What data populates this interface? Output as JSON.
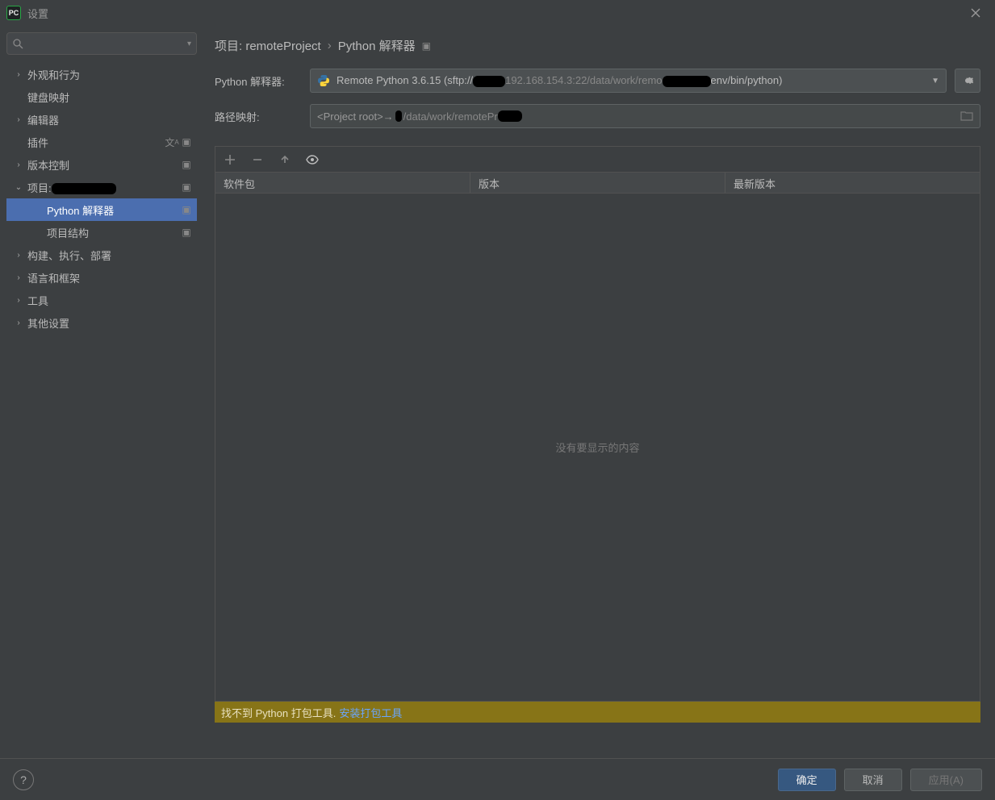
{
  "titlebar": {
    "title": "设置"
  },
  "search": {
    "placeholder": ""
  },
  "sidebar": {
    "items": [
      {
        "label": "外观和行为",
        "expandable": true,
        "level": 0,
        "selected": false
      },
      {
        "label": "键盘映射",
        "expandable": false,
        "level": 0,
        "selected": false,
        "noIndent": true
      },
      {
        "label": "编辑器",
        "expandable": true,
        "level": 0,
        "selected": false
      },
      {
        "label": "插件",
        "expandable": false,
        "level": 0,
        "selected": false,
        "noIndent": true,
        "trailing": "lang"
      },
      {
        "label": "版本控制",
        "expandable": true,
        "level": 0,
        "selected": false,
        "trailing": "square"
      },
      {
        "label": "项目:",
        "expandable": true,
        "expanded": true,
        "level": 0,
        "selected": false,
        "trailing": "square",
        "redacted": "remoteProject"
      },
      {
        "label": "Python 解释器",
        "expandable": false,
        "level": 1,
        "selected": true,
        "trailing": "square"
      },
      {
        "label": "项目结构",
        "expandable": false,
        "level": 1,
        "selected": false,
        "trailing": "square"
      },
      {
        "label": "构建、执行、部署",
        "expandable": true,
        "level": 0,
        "selected": false
      },
      {
        "label": "语言和框架",
        "expandable": true,
        "level": 0,
        "selected": false
      },
      {
        "label": "工具",
        "expandable": true,
        "level": 0,
        "selected": false
      },
      {
        "label": "其他设置",
        "expandable": true,
        "level": 0,
        "selected": false
      }
    ]
  },
  "breadcrumb": {
    "part1": "项目: remoteProject",
    "part2": "Python 解释器"
  },
  "interpreter_row": {
    "label": "Python 解释器:",
    "value_prefix": "Remote Python 3.6.15 (sftp://",
    "value_mid": "192.168.154.3:22/data/work/remo",
    "value_suffix": "env/bin/python)"
  },
  "path_row": {
    "label": "路径映射:",
    "value_prefix": "<Project root>→",
    "value_mid": "/data/work/remotePr"
  },
  "packages": {
    "col1": "软件包",
    "col2": "版本",
    "col3": "最新版本",
    "empty": "没有要显示的内容"
  },
  "warning": {
    "text": "找不到 Python 打包工具.",
    "link": "安装打包工具"
  },
  "footer": {
    "ok": "确定",
    "cancel": "取消",
    "apply": "应用(A)"
  }
}
